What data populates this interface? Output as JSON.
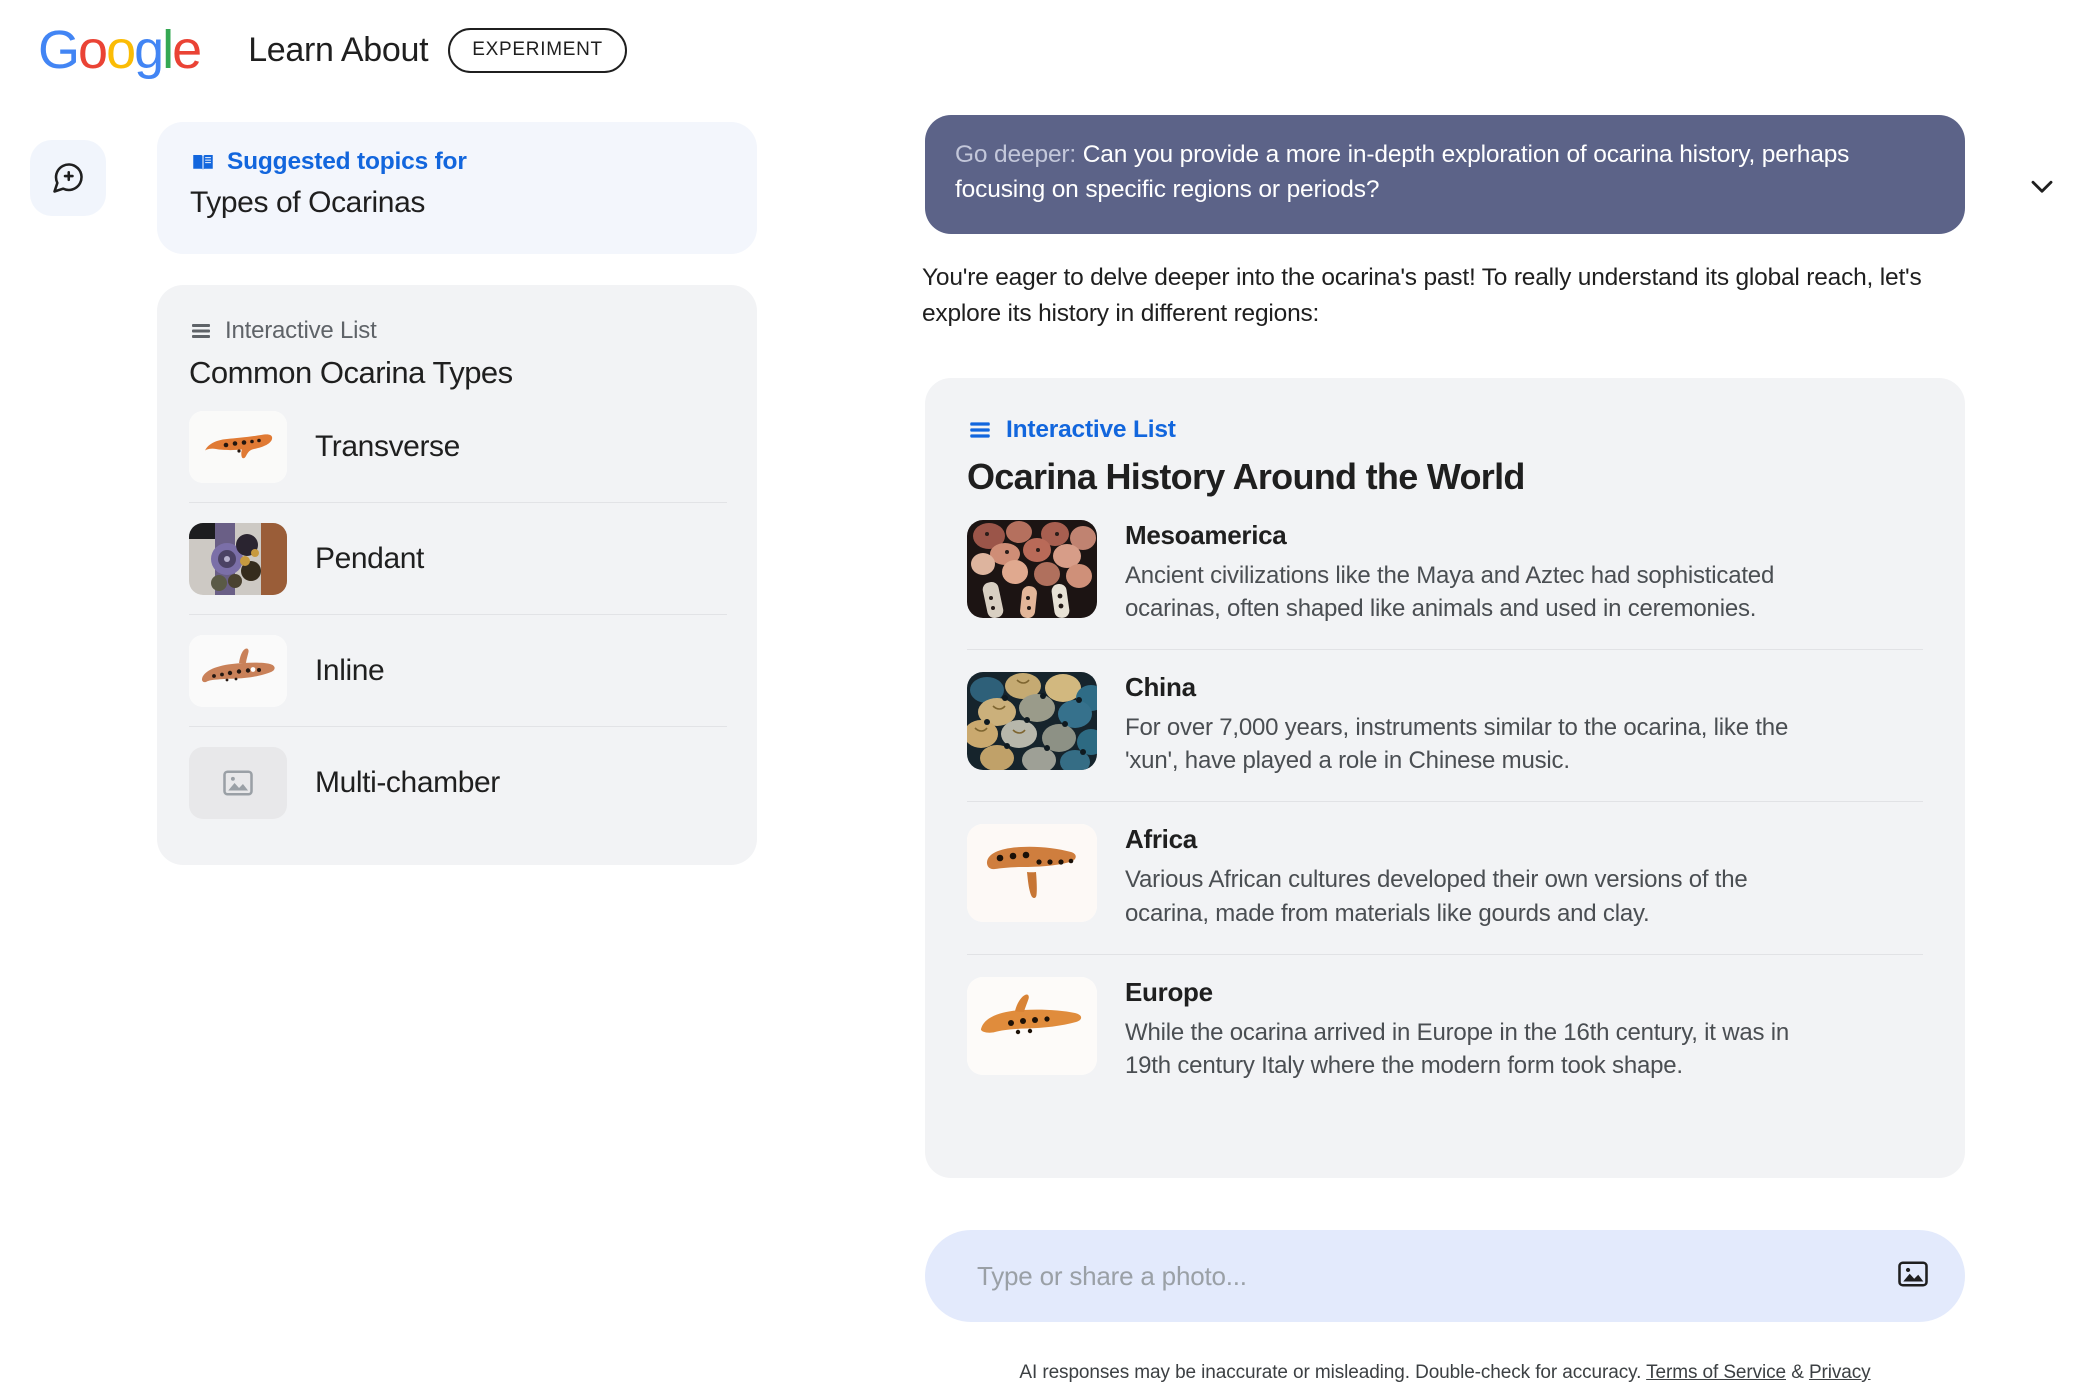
{
  "header": {
    "logo_text": "Google",
    "app_title": "Learn About",
    "badge": "EXPERIMENT"
  },
  "sidebar": {
    "new_chat_icon": "new-chat-icon",
    "suggested": {
      "icon": "book-icon",
      "eyebrow": "Suggested topics for",
      "title": "Types of Ocarinas",
      "chevron": "chevron-down-icon"
    },
    "list_card": {
      "icon": "list-icon",
      "eyebrow": "Interactive List",
      "title": "Common Ocarina Types",
      "items": [
        {
          "label": "Transverse",
          "thumb": "transverse-ocarina-photo"
        },
        {
          "label": "Pendant",
          "thumb": "pendant-ocarina-photo"
        },
        {
          "label": "Inline",
          "thumb": "inline-ocarina-photo"
        },
        {
          "label": "Multi-chamber",
          "thumb": "image-placeholder-icon"
        }
      ]
    }
  },
  "conversation": {
    "user_message_prefix": "Go deeper:",
    "user_message": " Can you provide a more in-depth exploration of ocarina history, perhaps focusing on specific regions or periods?",
    "assistant_intro": "You're eager to delve deeper into the ocarina's past! To really understand its global reach, let's explore its history in different regions:",
    "result_card": {
      "icon": "list-icon",
      "eyebrow": "Interactive List",
      "title": "Ocarina History Around the World",
      "items": [
        {
          "title": "Mesoamerica",
          "description": "Ancient civilizations like the Maya and Aztec had sophisticated ocarinas, often shaped like animals and used in ceremonies.",
          "thumb": "mesoamerica-clay-ocarinas-photo"
        },
        {
          "title": "China",
          "description": "For over 7,000 years, instruments similar to the ocarina, like the 'xun', have played a role in Chinese music.",
          "thumb": "china-xun-vessels-photo"
        },
        {
          "title": "Africa",
          "description": "Various African cultures developed their own versions of the ocarina, made from materials like gourds and clay.",
          "thumb": "africa-gourd-ocarina-photo"
        },
        {
          "title": "Europe",
          "description": "While the ocarina arrived in Europe in the 16th century, it was in 19th century Italy where the modern form took shape.",
          "thumb": "europe-ocarina-photo"
        }
      ]
    }
  },
  "composer": {
    "placeholder": "Type or share a photo...",
    "value": "",
    "image_icon": "image-upload-icon"
  },
  "footer": {
    "disclaimer": "AI responses may be inaccurate or misleading. Double-check for accuracy.",
    "terms_link": "Terms of Service",
    "separator": "&",
    "privacy_link": "Privacy"
  },
  "colors": {
    "brand_blue": "#1266dd",
    "user_bubble": "#5c6388",
    "card_gray": "#f2f3f5",
    "suggested_bg": "#f3f6fc",
    "composer_bg": "#e3eafc"
  }
}
